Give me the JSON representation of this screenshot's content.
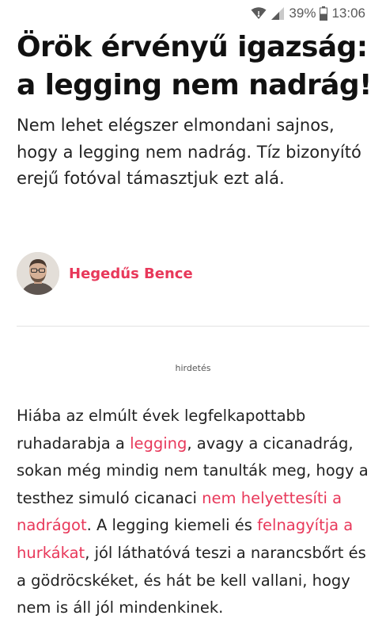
{
  "status_bar": {
    "battery_percent": "39%",
    "time": "13:06",
    "icons": [
      "wifi-icon",
      "signal-icon",
      "battery-icon"
    ]
  },
  "article": {
    "headline": "Örök érvényű igazság: a legging nem nadrág!",
    "lead": "Nem lehet elégszer elmondani sajnos, hogy a legging nem nadrág. Tíz bizonyító erejű fotóval támasztjuk ezt alá.",
    "author": {
      "name": "Hegedűs Bence"
    },
    "ad_label": "hirdetés",
    "body": {
      "t1": "Hiába az elmúlt évek legfelkapottabb ruhadarabja a ",
      "link1": "legging",
      "t2": ", avagy a cicanadrág, sokan még mindig nem tanulták meg, hogy a testhez simuló cicanaci ",
      "link2": "nem helyettesíti a nadrágot",
      "t3": ". A legging kiemeli és ",
      "link3": "felnagyítja a hurkákat",
      "t4": ", jól láthatóvá teszi a narancsbőrt és a gödröcskéket, és hát be kell vallani, hogy nem is áll jól mindenkinek."
    }
  },
  "colors": {
    "accent": "#e8385a",
    "text": "#222222",
    "headline": "#111111",
    "status_icons": "#5a5a5a"
  }
}
